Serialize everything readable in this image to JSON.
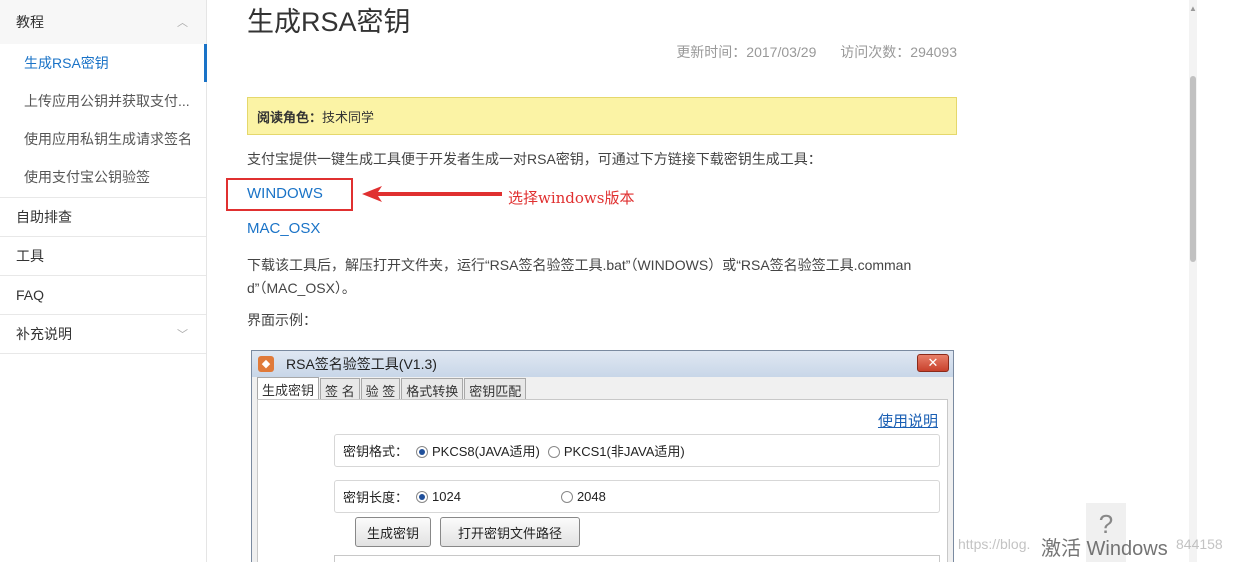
{
  "sidebar": {
    "section1": {
      "label": "教程",
      "chevron": "chevron-up-icon"
    },
    "items": [
      {
        "label": "生成RSA密钥",
        "active": true
      },
      {
        "label": "上传应用公钥并获取支付..."
      },
      {
        "label": "使用应用私钥生成请求签名"
      },
      {
        "label": "使用支付宝公钥验签"
      }
    ],
    "section2": {
      "label": "自助排查"
    },
    "section3": {
      "label": "工具"
    },
    "section4": {
      "label": "FAQ"
    },
    "section5": {
      "label": "补充说明",
      "chevron": "chevron-down-icon"
    }
  },
  "article": {
    "title": "生成RSA密钥",
    "updated": "更新时间：2017/03/29",
    "visits": "访问次数：294093",
    "notice_label": "阅读角色：",
    "notice_value": "技术同学",
    "intro": "支付宝提供一键生成工具便于开发者生成一对RSA密钥，可通过下方链接下载密钥生成工具：",
    "link_windows": "WINDOWS",
    "link_mac": "MAC_OSX",
    "para2_line1": "下载该工具后，解压打开文件夹，运行“RSA签名验签工具.bat”（WINDOWS）或“RSA签名验签工具.comman",
    "para2_line2": "d”（MAC_OSX）。",
    "example_label": "界面示例："
  },
  "annotation": {
    "text": "选择windows版本",
    "color": "#e03030"
  },
  "tool_window": {
    "title": "RSA签名验签工具(V1.3)",
    "close": "✕",
    "tabs": [
      "生成密钥",
      "签 名",
      "验 签",
      "格式转换",
      "密钥匹配"
    ],
    "usage_link": "使用说明",
    "format_label": "密钥格式：",
    "format_opt1": "PKCS8(JAVA适用)",
    "format_opt2": "PKCS1(非JAVA适用)",
    "length_label": "密钥长度：",
    "length_opt1": "1024",
    "length_opt2": "2048",
    "btn_generate": "生成密钥",
    "btn_open_path": "打开密钥文件路径"
  },
  "overlays": {
    "help": "?",
    "activate_windows": "激活 Windows",
    "blog_url": "https://blog.",
    "blog_suffix": "844158"
  },
  "colors": {
    "link": "#1a73c7",
    "notice_bg": "#fbf3a5",
    "annotation_red": "#e03030"
  }
}
